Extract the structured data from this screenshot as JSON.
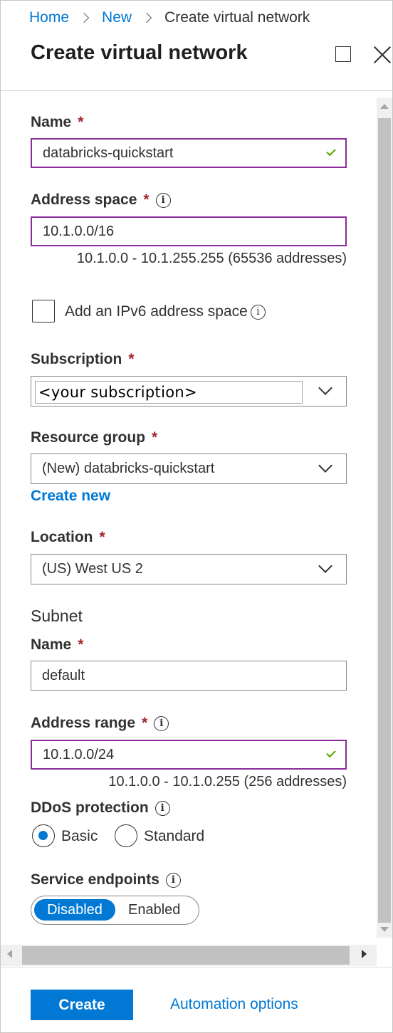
{
  "breadcrumb": {
    "items": [
      "Home",
      "New"
    ],
    "current": "Create virtual network"
  },
  "panel": {
    "title": "Create virtual network"
  },
  "form": {
    "required_mark": "*",
    "name": {
      "label": "Name",
      "value": "databricks-quickstart"
    },
    "address_space": {
      "label": "Address space",
      "value": "10.1.0.0/16",
      "hint": "10.1.0.0 - 10.1.255.255 (65536 addresses)"
    },
    "ipv6": {
      "label": "Add an IPv6 address space",
      "checked": false
    },
    "subscription": {
      "label": "Subscription",
      "value": "<your subscription>"
    },
    "resource_group": {
      "label": "Resource group",
      "value": "(New) databricks-quickstart",
      "create_new_label": "Create new"
    },
    "location": {
      "label": "Location",
      "value": "(US) West US 2"
    },
    "subnet": {
      "section_title": "Subnet",
      "name": {
        "label": "Name",
        "value": "default"
      },
      "address_range": {
        "label": "Address range",
        "value": "10.1.0.0/24",
        "hint": "10.1.0.0 - 10.1.0.255 (256 addresses)"
      }
    },
    "ddos": {
      "label": "DDoS protection",
      "options": [
        "Basic",
        "Standard"
      ],
      "selected": "Basic"
    },
    "service_endpoints": {
      "label": "Service endpoints",
      "options": [
        "Disabled",
        "Enabled"
      ],
      "selected": "Disabled"
    }
  },
  "footer": {
    "create_label": "Create",
    "automation_label": "Automation options"
  },
  "icons": {
    "info": "i"
  },
  "colors": {
    "accent": "#0078d4",
    "required": "#a4262c",
    "valid_border": "#8a2d9b",
    "valid_check": "#57a300"
  }
}
